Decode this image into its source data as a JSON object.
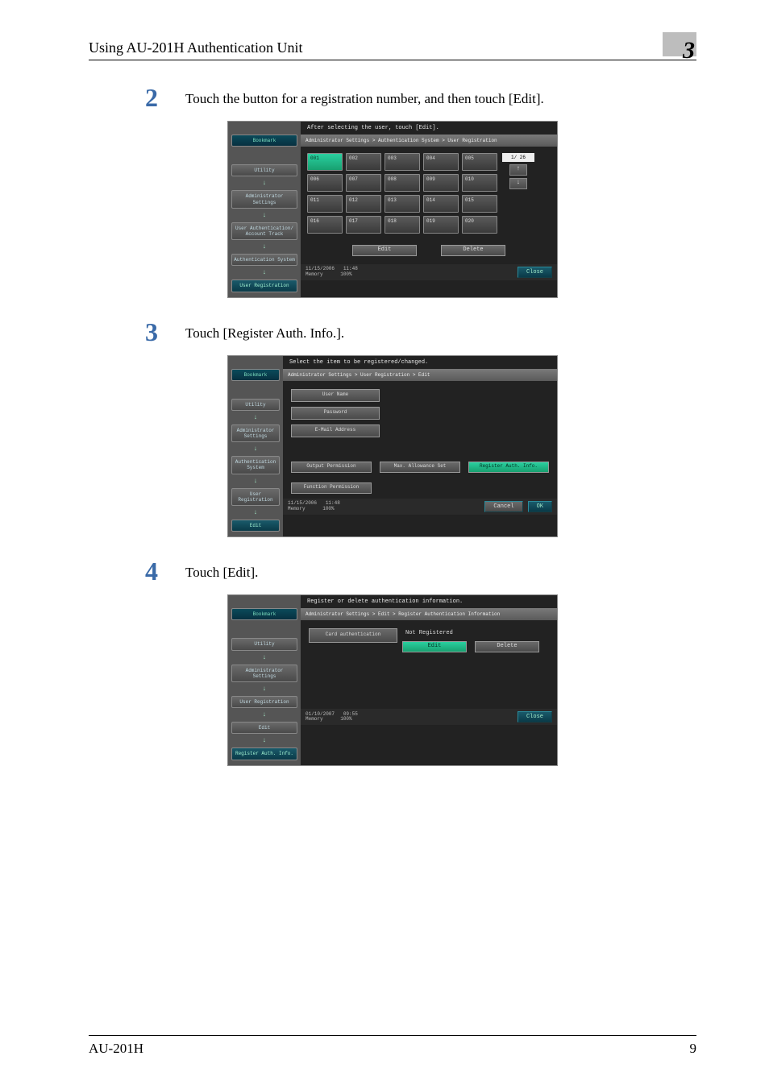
{
  "header": {
    "title": "Using AU-201H Authentication Unit",
    "chapter": "3"
  },
  "steps": {
    "s2": {
      "num": "2",
      "text": "Touch the button for a registration number, and then touch [Edit]."
    },
    "s3": {
      "num": "3",
      "text": "Touch [Register Auth. Info.]."
    },
    "s4": {
      "num": "4",
      "text": "Touch [Edit]."
    }
  },
  "screen1": {
    "prompt": "After selecting the user, touch [Edit].",
    "breadcrumb": "Administrator Settings > Authentication System > User Registration",
    "side": {
      "bookmark": "Bookmark",
      "utility": "Utility",
      "admin": "Administrator Settings",
      "userauth": "User Authentication/ Account Track",
      "authsys": "Authentication System",
      "userreg": "User Registration"
    },
    "nums": [
      "001",
      "002",
      "003",
      "004",
      "005",
      "006",
      "007",
      "008",
      "009",
      "010",
      "011",
      "012",
      "013",
      "014",
      "015",
      "016",
      "017",
      "018",
      "019",
      "020"
    ],
    "pager": "1/ 26",
    "edit": "Edit",
    "delete": "Delete",
    "status": {
      "date": "11/15/2006",
      "time": "11:48",
      "mem": "Memory",
      "pct": "100%"
    },
    "close": "Close"
  },
  "screen2": {
    "prompt": "Select the item to be registered/changed.",
    "breadcrumb": "Administrator Settings > User Registration > Edit",
    "side": {
      "bookmark": "Bookmark",
      "utility": "Utility",
      "admin": "Administrator Settings",
      "authsys": "Authentication System",
      "userreg": "User Registration",
      "edit": "Edit"
    },
    "fields": {
      "username": "User Name",
      "password": "Password",
      "email": "E-Mail Address"
    },
    "perms": {
      "output": "Output Permission",
      "max": "Max. Allowance Set",
      "reg": "Register Auth. Info.",
      "func": "Function Permission"
    },
    "status": {
      "date": "11/15/2006",
      "time": "11:48",
      "mem": "Memory",
      "pct": "100%"
    },
    "cancel": "Cancel",
    "ok": "OK"
  },
  "screen3": {
    "prompt": "Register or delete authentication information.",
    "breadcrumb": "Administrator Settings > Edit > Register Authentication Information",
    "side": {
      "bookmark": "Bookmark",
      "utility": "Utility",
      "admin": "Administrator Settings",
      "userreg": "User Registration",
      "edit": "Edit",
      "regauth": "Register Auth. Info."
    },
    "card": {
      "label": "Card authentication",
      "status": "Not Registered",
      "edit": "Edit",
      "delete": "Delete"
    },
    "status": {
      "date": "01/10/2007",
      "time": "09:55",
      "mem": "Memory",
      "pct": "100%"
    },
    "close": "Close"
  },
  "footer": {
    "model": "AU-201H",
    "page": "9"
  }
}
